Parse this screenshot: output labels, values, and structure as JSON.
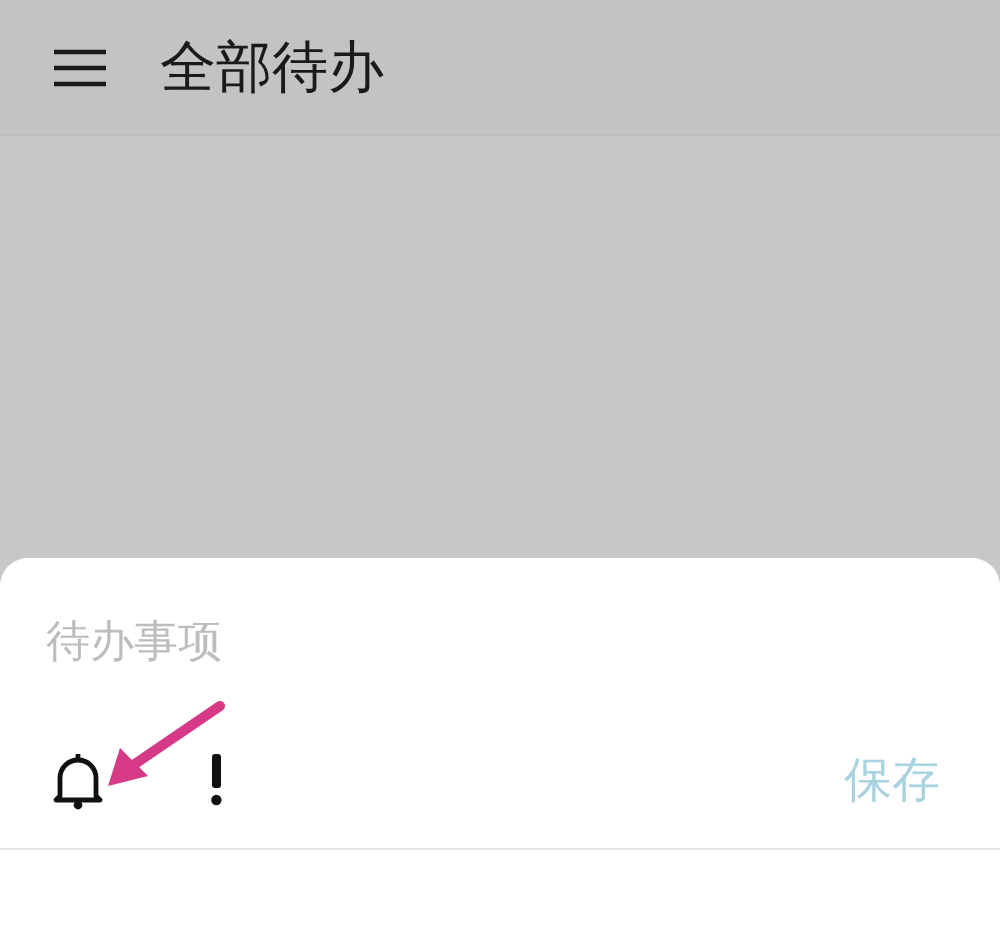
{
  "app_bar": {
    "title": "全部待办"
  },
  "sheet": {
    "input": {
      "placeholder": "待办事项"
    },
    "save_button": {
      "label": "保存",
      "disabled": true
    }
  }
}
